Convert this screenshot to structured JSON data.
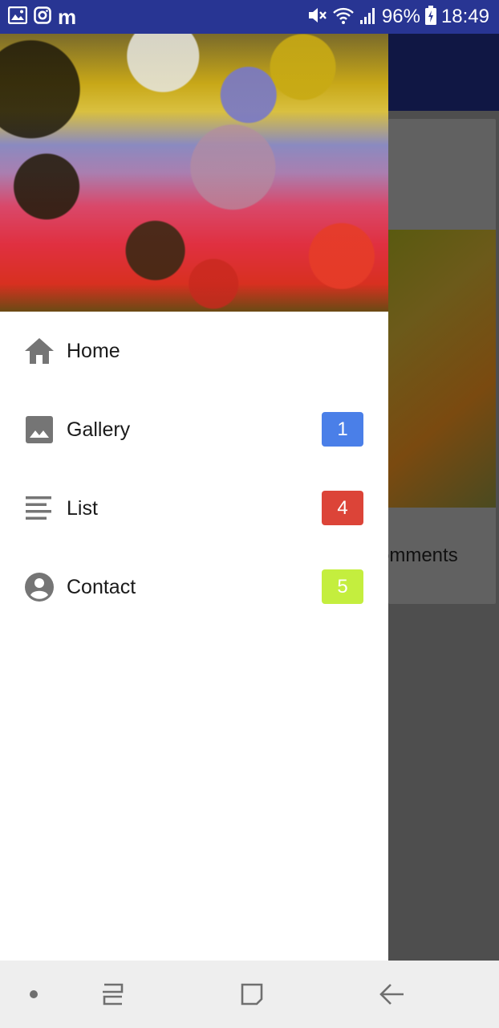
{
  "status_bar": {
    "left_icons": [
      "gallery-icon",
      "instagram-icon",
      "m-app-icon"
    ],
    "m_glyph": "m",
    "battery_percent": "96%",
    "time": "18:49",
    "right_icons": [
      "mute-icon",
      "wifi-icon",
      "signal-icon",
      "battery-charging-icon"
    ],
    "background": "#283593"
  },
  "background_app": {
    "card_text": "omments",
    "toolbar_color": "#101744"
  },
  "drawer": {
    "menu": [
      {
        "label": "Home",
        "icon": "home-icon",
        "badge": null
      },
      {
        "label": "Gallery",
        "icon": "image-icon",
        "badge": "1",
        "badge_color": "#4a7fe8"
      },
      {
        "label": "List",
        "icon": "list-icon",
        "badge": "4",
        "badge_color": "#dc4438"
      },
      {
        "label": "Contact",
        "icon": "account-circle-icon",
        "badge": "5",
        "badge_color": "#c4ee3e"
      }
    ]
  },
  "nav_bar": {
    "buttons": [
      "dot-icon",
      "recent-apps-icon",
      "home-square-icon",
      "back-arrow-icon"
    ]
  }
}
